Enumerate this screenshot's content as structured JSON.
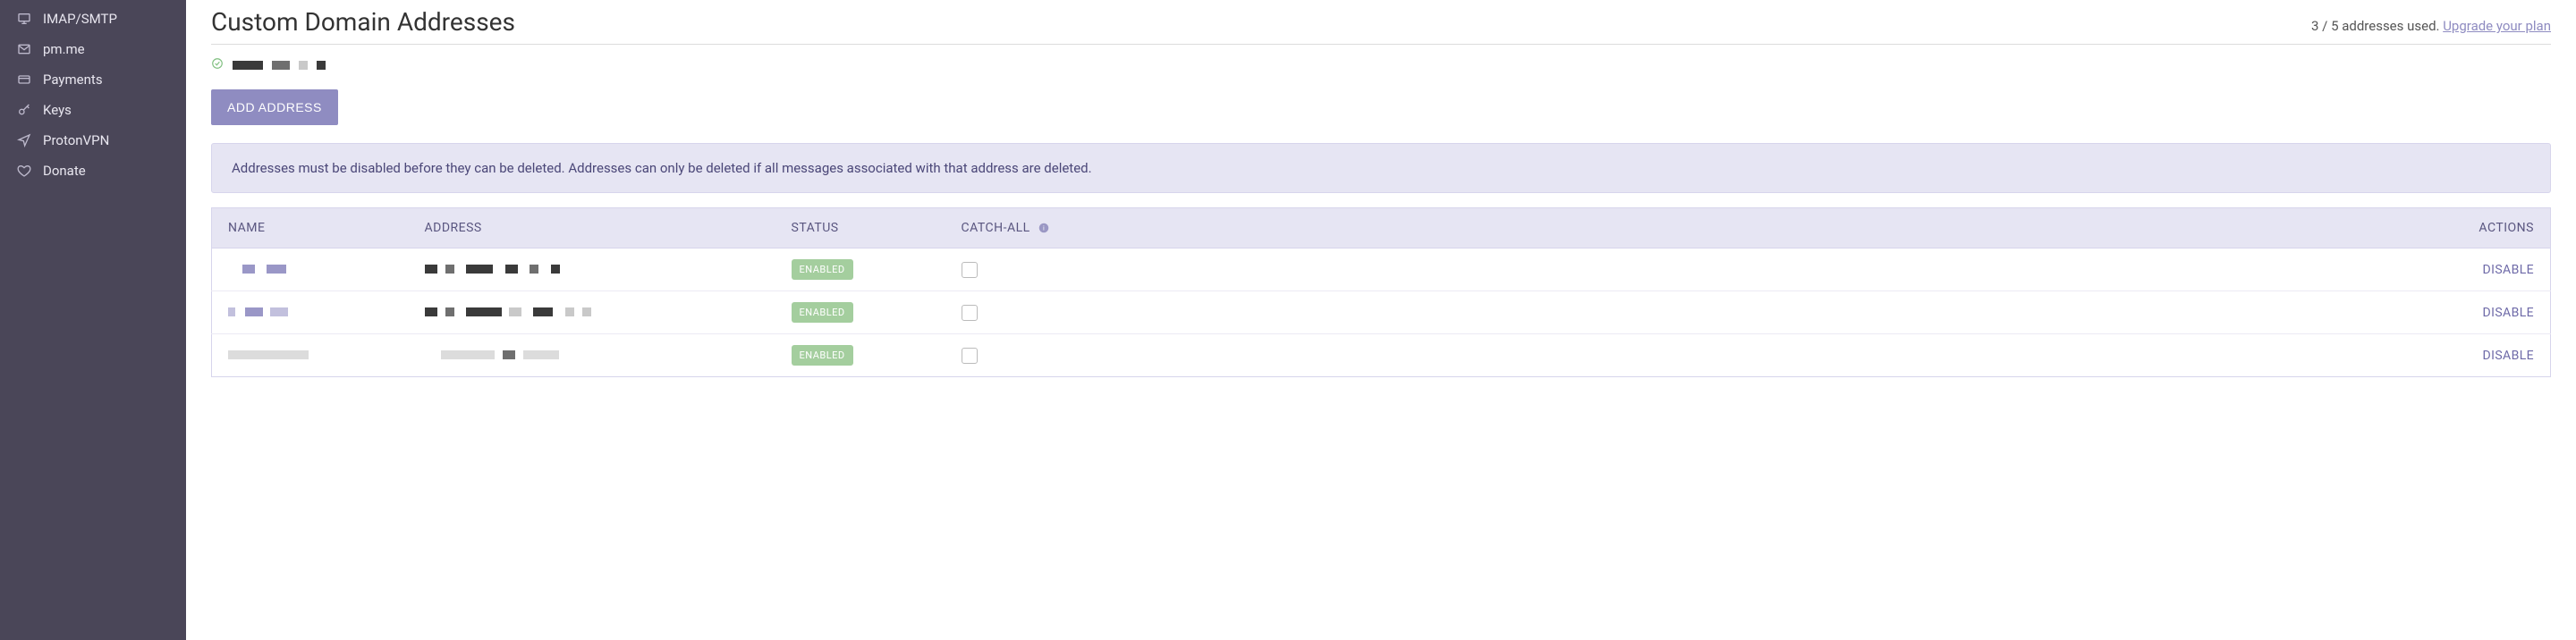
{
  "sidebar": {
    "items": [
      {
        "label": "IMAP/SMTP",
        "icon": "monitor"
      },
      {
        "label": "pm.me",
        "icon": "envelope"
      },
      {
        "label": "Payments",
        "icon": "card"
      },
      {
        "label": "Keys",
        "icon": "key"
      },
      {
        "label": "ProtonVPN",
        "icon": "send"
      },
      {
        "label": "Donate",
        "icon": "heart"
      }
    ]
  },
  "header": {
    "title": "Custom Domain Addresses",
    "usage_prefix": "3 / 5 addresses used. ",
    "upgrade_link": "Upgrade your plan"
  },
  "add_button": "ADD ADDRESS",
  "info_banner": "Addresses must be disabled before they can be deleted. Addresses can only be deleted if all messages associated with that address are deleted.",
  "table": {
    "columns": {
      "name": "NAME",
      "address": "ADDRESS",
      "status": "STATUS",
      "catchall": "CATCH-ALL",
      "actions": "ACTIONS"
    },
    "rows": [
      {
        "status": "ENABLED",
        "action": "DISABLE",
        "catchall": false
      },
      {
        "status": "ENABLED",
        "action": "DISABLE",
        "catchall": false
      },
      {
        "status": "ENABLED",
        "action": "DISABLE",
        "catchall": false
      }
    ]
  }
}
